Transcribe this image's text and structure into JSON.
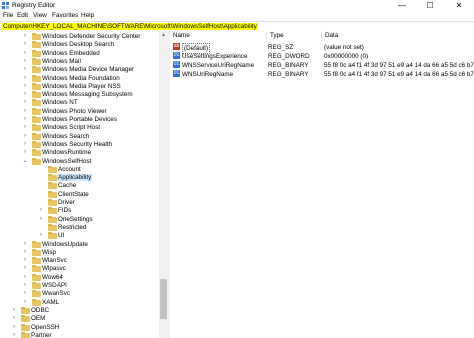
{
  "window": {
    "title": "Registry Editor",
    "minimize": "—",
    "maximize": "☐",
    "close": "✕"
  },
  "menu": [
    "File",
    "Edit",
    "View",
    "Favorites",
    "Help"
  ],
  "address": "Computer\\HKEY_LOCAL_MACHINE\\SOFTWARE\\Microsoft\\WindowsSelfHost\\Applicability",
  "tree": [
    {
      "label": "Windows Defender Security Center",
      "level": 1,
      "expander": "›"
    },
    {
      "label": "Windows Desktop Search",
      "level": 1,
      "expander": "›"
    },
    {
      "label": "Windows Embedded",
      "level": 1,
      "expander": "›"
    },
    {
      "label": "Windows Mail",
      "level": 1,
      "expander": "›"
    },
    {
      "label": "Windows Media Device Manager",
      "level": 1,
      "expander": "›"
    },
    {
      "label": "Windows Media Foundation",
      "level": 1,
      "expander": "›"
    },
    {
      "label": "Windows Media Player NSS",
      "level": 1,
      "expander": "›"
    },
    {
      "label": "Windows Messaging Subsystem",
      "level": 1,
      "expander": "›"
    },
    {
      "label": "Windows NT",
      "level": 1,
      "expander": "›"
    },
    {
      "label": "Windows Photo Viewer",
      "level": 1,
      "expander": "›"
    },
    {
      "label": "Windows Portable Devices",
      "level": 1,
      "expander": "›"
    },
    {
      "label": "Windows Script Host",
      "level": 1,
      "expander": "›"
    },
    {
      "label": "Windows Search",
      "level": 1,
      "expander": "›"
    },
    {
      "label": "Windows Security Health",
      "level": 1,
      "expander": "›"
    },
    {
      "label": "WindowsRuntime",
      "level": 1,
      "expander": "›"
    },
    {
      "label": "WindowsSelfHost",
      "level": 1,
      "expander": "⌄"
    },
    {
      "label": "Account",
      "level": 2,
      "expander": ""
    },
    {
      "label": "Applicability",
      "level": 2,
      "expander": "",
      "selected": true
    },
    {
      "label": "Cache",
      "level": 2,
      "expander": ""
    },
    {
      "label": "ClientState",
      "level": 2,
      "expander": ""
    },
    {
      "label": "Driver",
      "level": 2,
      "expander": ""
    },
    {
      "label": "FIDs",
      "level": 2,
      "expander": "›"
    },
    {
      "label": "OneSettings",
      "level": 2,
      "expander": "›"
    },
    {
      "label": "Restricted",
      "level": 2,
      "expander": ""
    },
    {
      "label": "UI",
      "level": 2,
      "expander": "›"
    },
    {
      "label": "WindowsUpdate",
      "level": 1,
      "expander": "›"
    },
    {
      "label": "Wisp",
      "level": 1,
      "expander": "›"
    },
    {
      "label": "WlanSvc",
      "level": 1,
      "expander": "›"
    },
    {
      "label": "Wlpasvc",
      "level": 1,
      "expander": "›"
    },
    {
      "label": "Wow64",
      "level": 1,
      "expander": "›"
    },
    {
      "label": "WSDAPI",
      "level": 1,
      "expander": "›"
    },
    {
      "label": "WwanSvc",
      "level": 1,
      "expander": "›"
    },
    {
      "label": "XAML",
      "level": 1,
      "expander": "›"
    },
    {
      "label": "ODBC",
      "level": 0,
      "expander": "›"
    },
    {
      "label": "OEM",
      "level": 0,
      "expander": "›"
    },
    {
      "label": "OpenSSH",
      "level": 0,
      "expander": "›"
    },
    {
      "label": "Partner",
      "level": 0,
      "expander": "›"
    }
  ],
  "columns": [
    "Name",
    "Type",
    "Data"
  ],
  "values": [
    {
      "name": "(Default)",
      "type": "REG_SZ",
      "data": "(value not set)",
      "icon": "string-value-icon",
      "glyph": "ab",
      "kind": "sz"
    },
    {
      "name": "UseSettingsExperience",
      "type": "REG_DWORD",
      "data": "0x00000000 (0)",
      "icon": "binary-value-icon",
      "glyph": "01",
      "kind": "bin"
    },
    {
      "name": "WNSServiceUriRegName",
      "type": "REG_BINARY",
      "data": "55 f8 0c a4 f1 4f 3d 97 51 e9 a4 14 da 66 a5 5d c6 b7 ...",
      "icon": "binary-value-icon",
      "glyph": "01",
      "kind": "bin"
    },
    {
      "name": "WNSUriRegName",
      "type": "REG_BINARY",
      "data": "55 f8 0c a4 f1 4f 3d 97 51 e9 a4 14 da 66 a5 5d c6 b7 ...",
      "icon": "binary-value-icon",
      "glyph": "01",
      "kind": "bin"
    }
  ]
}
